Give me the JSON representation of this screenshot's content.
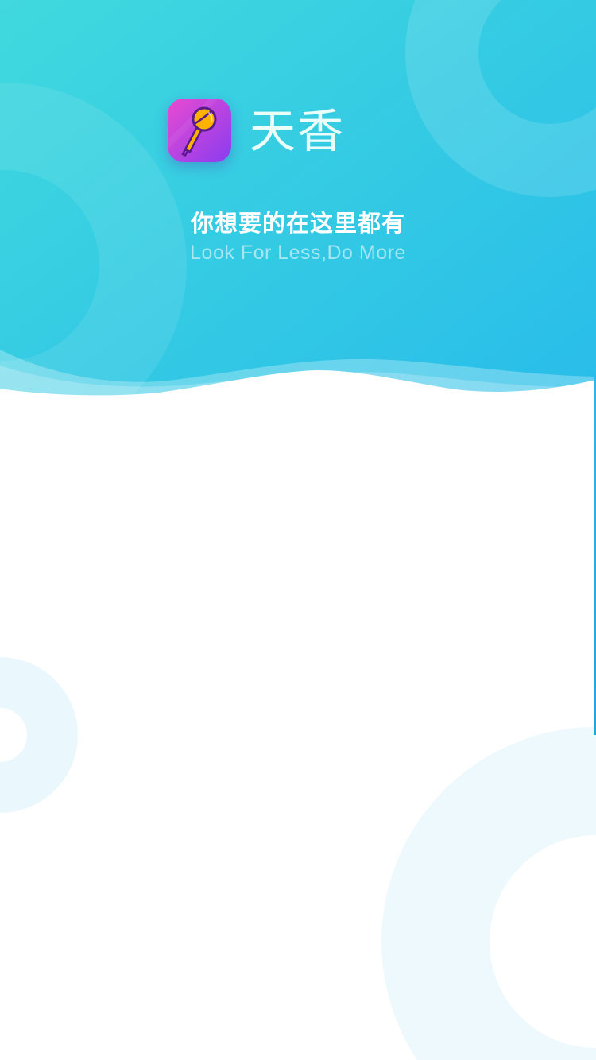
{
  "app": {
    "name": "天香",
    "icon": "microphone-icon"
  },
  "slogan": {
    "primary": "你想要的在这里都有",
    "secondary": "Look For Less,Do More"
  },
  "colors": {
    "header_gradient_start": "#3fd7df",
    "header_gradient_end": "#27bdea",
    "icon_gradient_start": "#e54bd2",
    "icon_gradient_end": "#8a3cf0",
    "microphone_head": "#ffb300",
    "deco_circle": "#eaf8fd"
  }
}
